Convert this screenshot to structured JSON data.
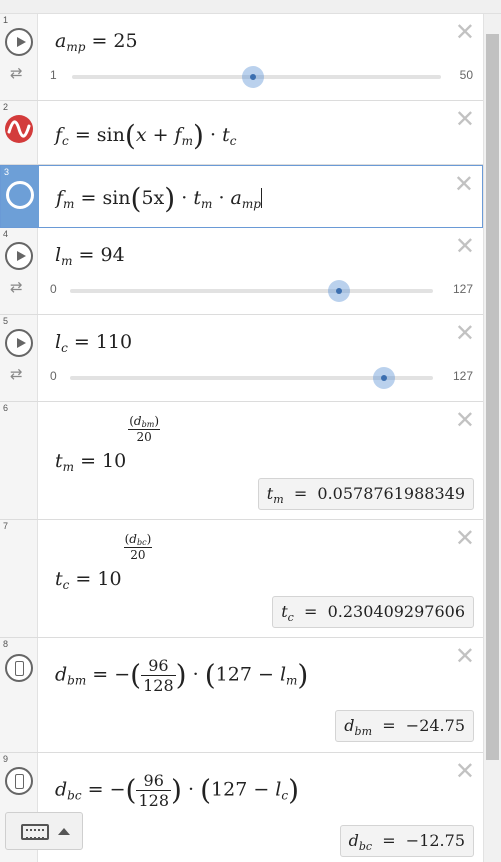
{
  "rows": [
    {
      "index": "1",
      "lhs_var": "a",
      "lhs_sub": "mp",
      "rhs": "25",
      "slider": {
        "min": "1",
        "max": "50",
        "value_fraction": 0.49
      }
    },
    {
      "index": "2",
      "lhs_var": "f",
      "lhs_sub": "c",
      "rhs_parts": {
        "fn": "sin",
        "x": "x",
        "plus": "+",
        "f": "f",
        "f_sub": "m",
        "dot": "·",
        "t": "t",
        "t_sub": "c"
      }
    },
    {
      "index": "3",
      "lhs_var": "f",
      "lhs_sub": "m",
      "rhs_parts": {
        "fn": "sin",
        "arg": "5x",
        "dot": "·",
        "t": "t",
        "t_sub": "m",
        "a": "a",
        "a_sub": "mp"
      }
    },
    {
      "index": "4",
      "lhs_var": "l",
      "lhs_sub": "m",
      "rhs": "94",
      "slider": {
        "min": "0",
        "max": "127",
        "value_fraction": 0.74
      }
    },
    {
      "index": "5",
      "lhs_var": "l",
      "lhs_sub": "c",
      "rhs": "110",
      "slider": {
        "min": "0",
        "max": "127",
        "value_fraction": 0.866
      }
    },
    {
      "index": "6",
      "lhs_var": "t",
      "lhs_sub": "m",
      "base": "10",
      "exp_var": "d",
      "exp_sub": "bm",
      "exp_den": "20",
      "result_var": "t",
      "result_sub": "m",
      "result_value": "0.0578761988349"
    },
    {
      "index": "7",
      "lhs_var": "t",
      "lhs_sub": "c",
      "base": "10",
      "exp_var": "d",
      "exp_sub": "bc",
      "exp_den": "20",
      "result_var": "t",
      "result_sub": "c",
      "result_value": "0.230409297606"
    },
    {
      "index": "8",
      "lhs_var": "d",
      "lhs_sub": "bm",
      "frac_num": "96",
      "frac_den": "128",
      "const": "127",
      "var": "l",
      "var_sub": "m",
      "result_var": "d",
      "result_sub": "bm",
      "result_value": "−24.75"
    },
    {
      "index": "9",
      "lhs_var": "d",
      "lhs_sub": "bc",
      "frac_num": "96",
      "frac_den": "128",
      "const": "127",
      "var": "l",
      "var_sub": "c",
      "result_var": "d",
      "result_sub": "bc",
      "result_value": "−12.75"
    }
  ],
  "symbols": {
    "equals": "=",
    "minus": "−",
    "close": "✕",
    "loop": "⇄"
  }
}
